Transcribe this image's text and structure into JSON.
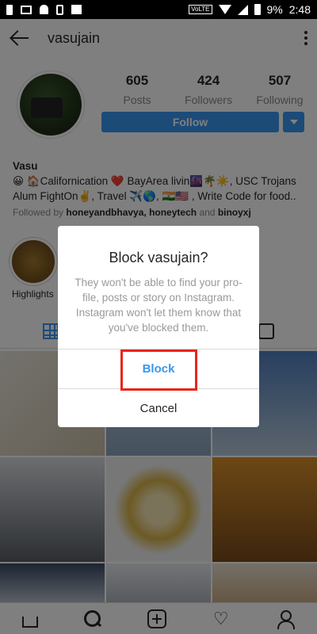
{
  "status_bar": {
    "volte": "VoLTE",
    "battery": "9%",
    "time": "2:48"
  },
  "header": {
    "title": "vasujain"
  },
  "profile": {
    "stats": [
      {
        "value": "605",
        "label": "Posts"
      },
      {
        "value": "424",
        "label": "Followers"
      },
      {
        "value": "507",
        "label": "Following"
      }
    ],
    "follow_label": "Follow",
    "name": "Vasu",
    "bio_line1": "😀 🏠Californication ❤️ BayArea livin🌆🌴☀️, USC Trojans",
    "bio_line2": "Alum FightOn✌️, Travel ✈️🌎, 🇮🇳🇺🇸 , Write Code for food..",
    "followed_by_prefix": "Followed by",
    "followed_by_names": "honeyandbhavya, honeytech",
    "followed_by_and": "and",
    "followed_by_last": "binoyxj",
    "highlights_label": "Highlights"
  },
  "dialog": {
    "title": "Block vasujain?",
    "message": "They won't be able to find your pro-file, posts or story on Instagram. Instagram won't let them know that you've blocked them.",
    "block_label": "Block",
    "cancel_label": "Cancel"
  },
  "colors": {
    "accent": "#3897f0",
    "highlight": "#e8261c"
  }
}
